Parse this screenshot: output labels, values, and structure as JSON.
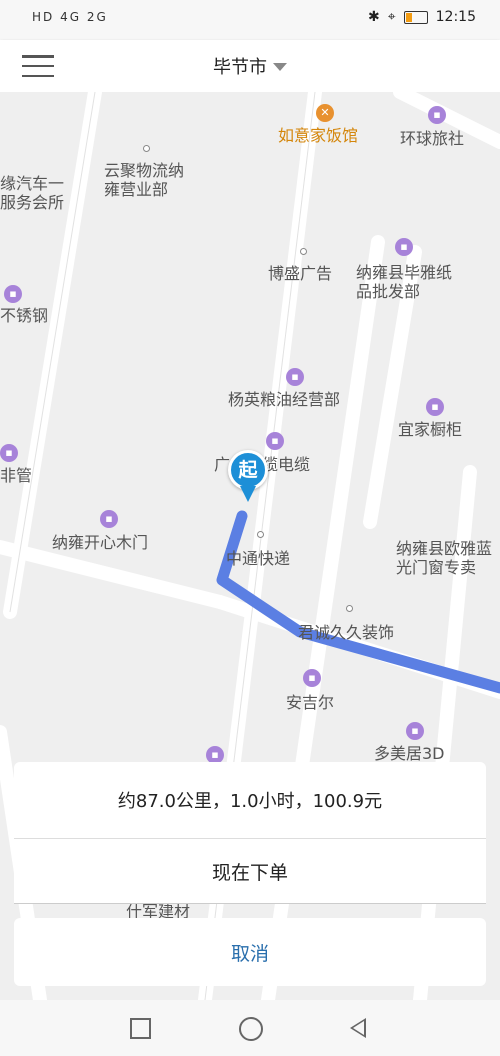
{
  "status_bar": {
    "left_icons": "HD 4G 2G",
    "time": "12:15"
  },
  "header": {
    "city": "毕节市"
  },
  "map": {
    "pois": [
      {
        "name": "如意家饭馆",
        "type": "restaurant"
      },
      {
        "name": "环球旅社",
        "type": "shop"
      },
      {
        "name": "云聚物流纳雍营业部",
        "type": "place"
      },
      {
        "name": "缘汽车一服务会所",
        "type": "place"
      },
      {
        "name": "博盛广告",
        "type": "place"
      },
      {
        "name": "纳雍县毕雅纸品批发部",
        "type": "shop"
      },
      {
        "name": "不锈钢",
        "type": "shop"
      },
      {
        "name": "杨英粮油经营部",
        "type": "shop"
      },
      {
        "name": "宜家橱柜",
        "type": "shop"
      },
      {
        "name": "广发线缆电缆",
        "type": "shop"
      },
      {
        "name": "非管",
        "type": "shop"
      },
      {
        "name": "纳雍开心木门",
        "type": "shop"
      },
      {
        "name": "中通快递",
        "type": "place"
      },
      {
        "name": "纳雍县欧雅蓝光门窗专卖",
        "type": "shop"
      },
      {
        "name": "君诚久久装饰",
        "type": "place"
      },
      {
        "name": "安吉尔",
        "type": "shop"
      },
      {
        "name": "多美居3D",
        "type": "shop"
      },
      {
        "name": "什军建材",
        "type": "place"
      }
    ],
    "start_marker_label": "起",
    "route_color": "#5b7fe3"
  },
  "panel": {
    "trip_info": "约87.0公里，1.0小时，100.9元",
    "order_now": "现在下单",
    "cancel": "取消"
  },
  "colors": {
    "accent_blue": "#2a6fad",
    "poi_orange": "#d4860b"
  }
}
